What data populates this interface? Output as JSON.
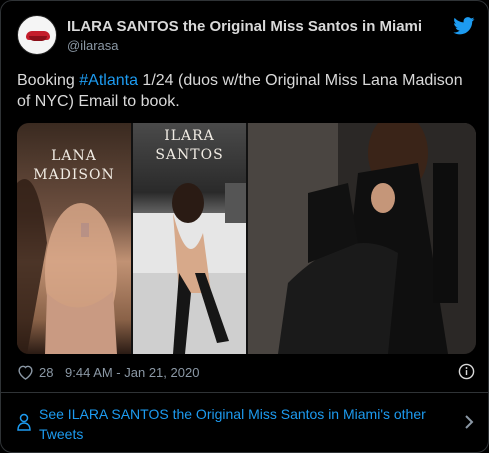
{
  "author": {
    "display_name": "ILARA SANTOS the Original Miss Santos in Miami",
    "handle": "@ilarasa"
  },
  "tweet": {
    "text_before": "Booking ",
    "hashtag": "#Atlanta",
    "text_after": " 1/24 (duos w/the Original Miss Lana Madison of NYC) Email to book."
  },
  "media": {
    "photo_1_label_line1": "LANA",
    "photo_1_label_line2": "MADISON",
    "photo_2_label_line1": "ILARA",
    "photo_2_label_line2": "SANTOS"
  },
  "meta": {
    "like_count": "28",
    "timestamp": "9:44 AM - Jan 21, 2020"
  },
  "footer": {
    "see_more": "See ILARA SANTOS the Original Miss Santos in Miami's other Tweets"
  },
  "colors": {
    "background": "#000000",
    "text": "#d9d9d9",
    "muted": "#8b98a5",
    "accent": "#1d9bf0"
  },
  "icons": [
    "avatar-lips",
    "twitter-bird-icon",
    "heart-icon",
    "info-icon",
    "person-icon",
    "chevron-right-icon"
  ]
}
